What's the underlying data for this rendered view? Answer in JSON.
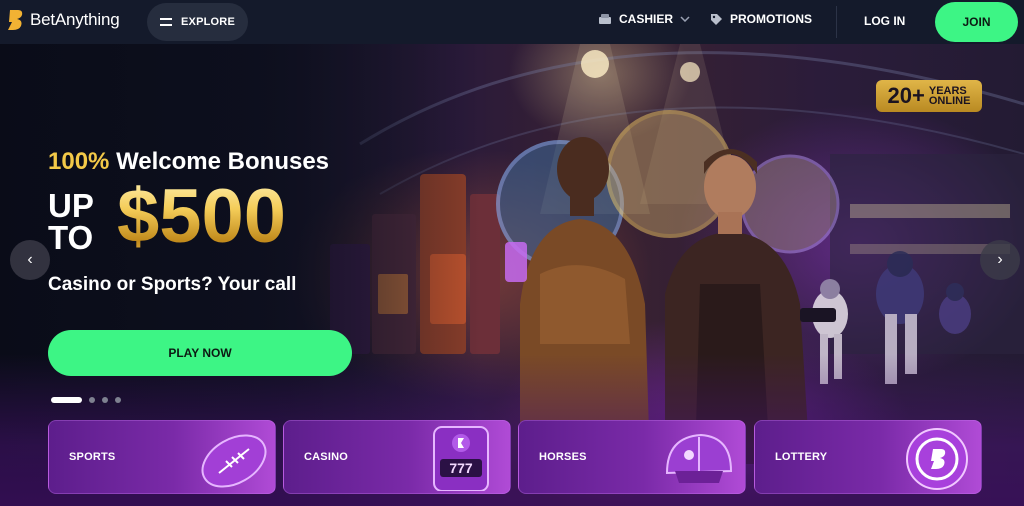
{
  "header": {
    "brand": "BetAnything",
    "explore_label": "EXPLORE",
    "cashier_label": "CASHIER",
    "promotions_label": "PROMOTIONS",
    "login_label": "LOG IN",
    "join_label": "JOIN"
  },
  "hero": {
    "badge_number": "20+",
    "badge_text_line1": "YEARS",
    "badge_text_line2": "ONLINE",
    "bonus_percent": "100%",
    "bonus_title": "Welcome Bonuses",
    "upto_line1": "UP",
    "upto_line2": "TO",
    "amount": "$500",
    "tagline": "Casino or Sports? Your call",
    "cta_label": "PLAY NOW",
    "slides_count": 4,
    "active_slide": 1,
    "prev_arrow": "‹",
    "next_arrow": "›"
  },
  "categories": [
    {
      "label": "SPORTS",
      "icon": "football-icon"
    },
    {
      "label": "CASINO",
      "icon": "slot-machine-icon"
    },
    {
      "label": "HORSES",
      "icon": "jockey-helmet-icon"
    },
    {
      "label": "LOTTERY",
      "icon": "lottery-ball-icon"
    }
  ],
  "colors": {
    "accent_green": "#3df585",
    "gold": "#f3c948",
    "header_bg": "#141a2b",
    "card_purple": "#7a2aa8"
  }
}
